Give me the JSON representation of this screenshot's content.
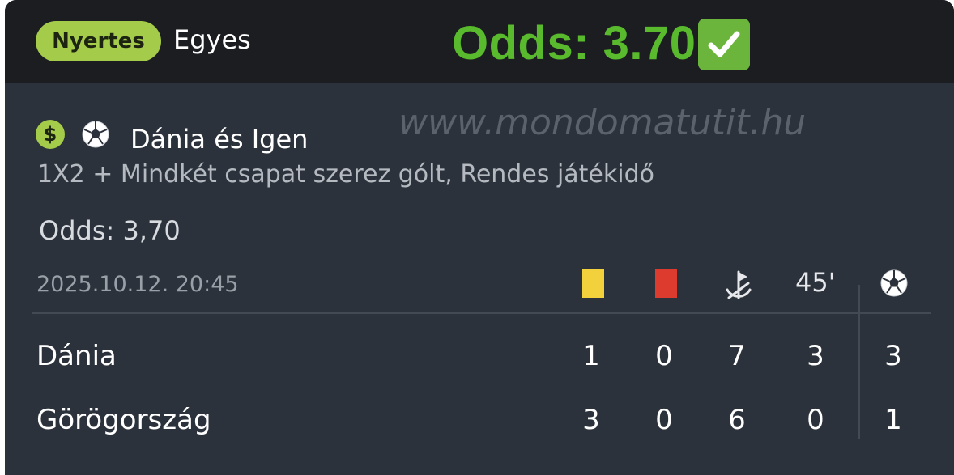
{
  "header": {
    "status_badge": "Nyertes",
    "bet_type": "Egyes",
    "odds_banner": "Odds: 3.70"
  },
  "selection": {
    "title": "Dánia és Igen",
    "market": "1X2 + Mindkét csapat szerez gólt, Rendes játékidő",
    "odds": "Odds: 3,70"
  },
  "watermark": "www.mondomatutit.hu",
  "match": {
    "datetime": "2025.10.12.  20:45",
    "columns": [
      "yellow-card",
      "red-card",
      "corners",
      "45'",
      "goals"
    ],
    "minute_label": "45'",
    "rows": [
      {
        "team": "Dánia",
        "yellow": "1",
        "red": "0",
        "corners": "7",
        "half": "3",
        "goals": "3"
      },
      {
        "team": "Görögország",
        "yellow": "3",
        "red": "0",
        "corners": "6",
        "half": "0",
        "goals": "1"
      }
    ]
  },
  "colors": {
    "accent_green": "#a4cb4a",
    "odds_green": "#58ba2c",
    "card_bg": "#2b323b",
    "header_bg": "#1b1d21",
    "yellow_card": "#f2d13c",
    "red_card": "#dd3b2e"
  },
  "icons": [
    "dollar-icon",
    "soccer-ball-icon",
    "check-mark-icon",
    "yellow-card-icon",
    "red-card-icon",
    "corner-flag-icon"
  ]
}
